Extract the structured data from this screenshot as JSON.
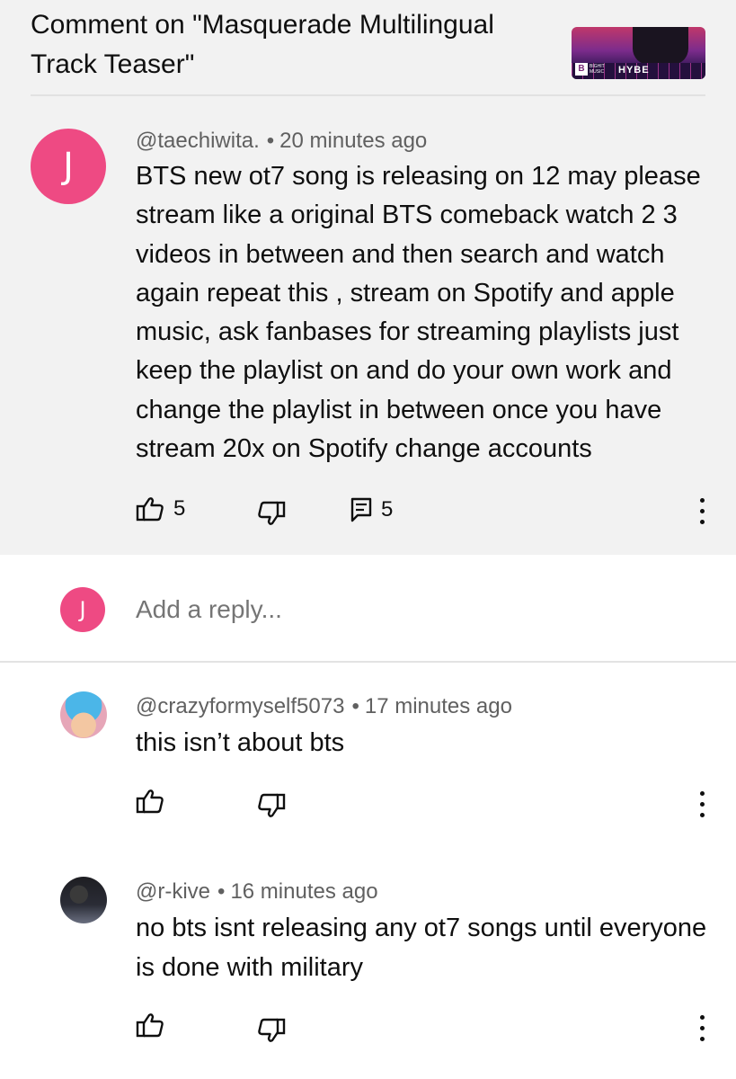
{
  "video": {
    "title": "Comment on \"Masquerade Multilingual Track Teaser\"",
    "thumbnail_logo": "B",
    "thumbnail_label": "BIGHIT MUSIC",
    "thumbnail_brand": "HYBE"
  },
  "main_comment": {
    "avatar_letter": "J",
    "avatar_color": "#ee4a83",
    "author": "@taechiwita.",
    "separator": "•",
    "time": "20 minutes ago",
    "text": "BTS new ot7 song is releasing on 12 may please stream like a original BTS comeback watch 2 3 videos in between and then search and watch again repeat this , stream on Spotify and apple music, ask fanbases for streaming playlists just keep the playlist on and do your own work and change the playlist in between once you have stream 20x on Spotify change accounts",
    "likes": "5",
    "replies": "5",
    "icons": [
      "thumb-up-icon",
      "thumb-down-icon",
      "comment-icon",
      "more-vert-icon"
    ]
  },
  "reply_box": {
    "avatar_letter": "J",
    "placeholder": "Add a reply..."
  },
  "replies": [
    {
      "author": "@crazyformyself5073",
      "separator": "•",
      "time": "17 minutes ago",
      "text": "this isn’t about bts"
    },
    {
      "author": "@r-kive",
      "separator": "•",
      "time": "16 minutes ago",
      "text": "no bts isnt releasing any ot7 songs until everyone is done with military"
    }
  ],
  "colors": {
    "highlight_background": "#f2f2f2",
    "secondary_text": "#606060",
    "primary_text": "#0f0f0f"
  }
}
